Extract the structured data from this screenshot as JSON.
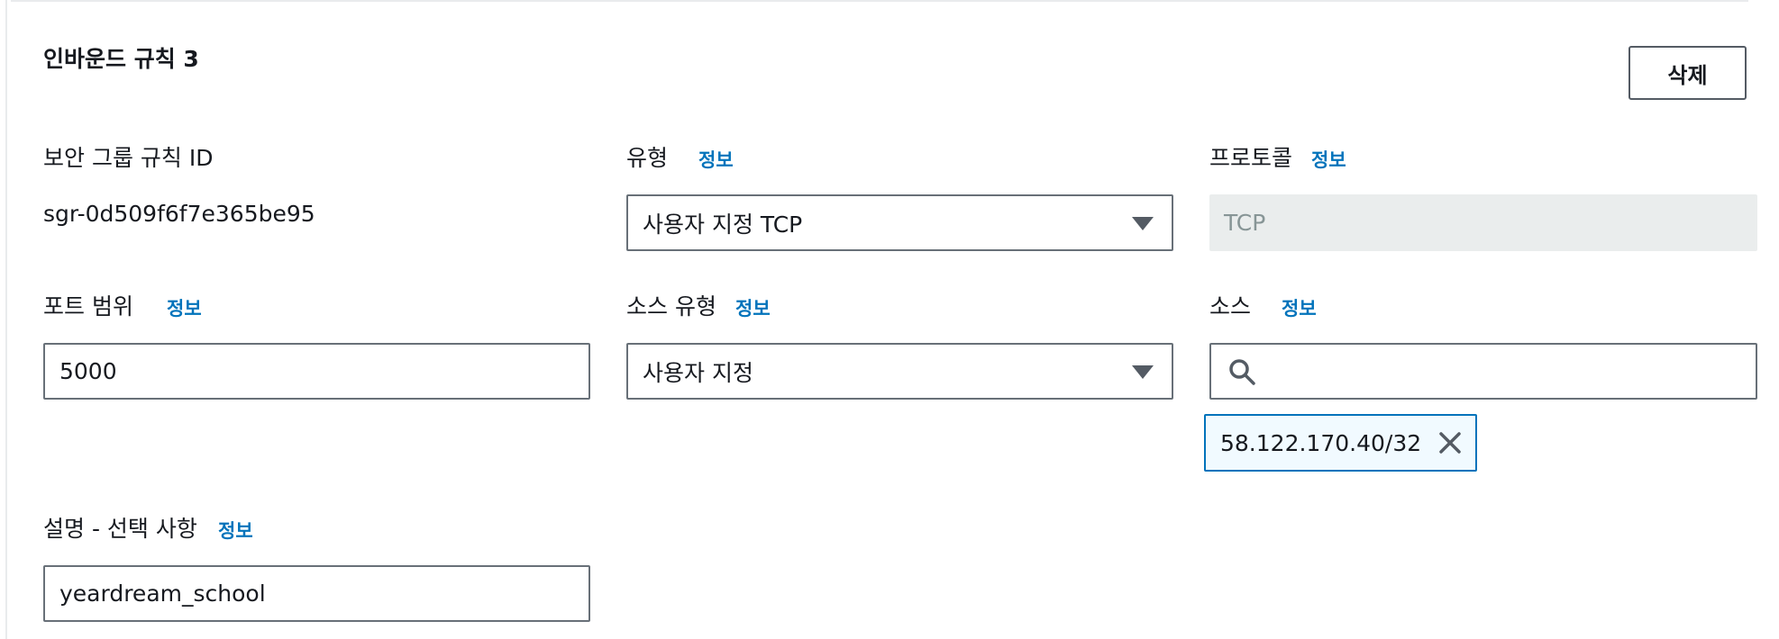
{
  "rule": {
    "title": "인바운드 규칙 3",
    "delete_label": "삭제"
  },
  "info_label": "정보",
  "fields": {
    "rule_id": {
      "label": "보안 그룹 규칙 ID",
      "value": "sgr-0d509f6f7e365be95"
    },
    "type": {
      "label": "유형",
      "value": "사용자 지정 TCP"
    },
    "protocol": {
      "label": "프로토콜",
      "value": "TCP"
    },
    "port_range": {
      "label": "포트 범위",
      "value": "5000"
    },
    "source_type": {
      "label": "소스 유형",
      "value": "사용자 지정"
    },
    "source": {
      "label": "소스",
      "search_value": "",
      "tokens": [
        "58.122.170.40/32"
      ]
    },
    "description": {
      "label": "설명 - 선택 사항",
      "value": "yeardream_school"
    }
  },
  "icons": {
    "select_arrow": "caret-down-icon",
    "search": "search-icon",
    "remove_token": "close-icon"
  },
  "colors": {
    "info_link": "#0073bb",
    "token_border": "#0073bb",
    "token_bg": "#f1faff",
    "disabled_bg": "#eaeded"
  }
}
